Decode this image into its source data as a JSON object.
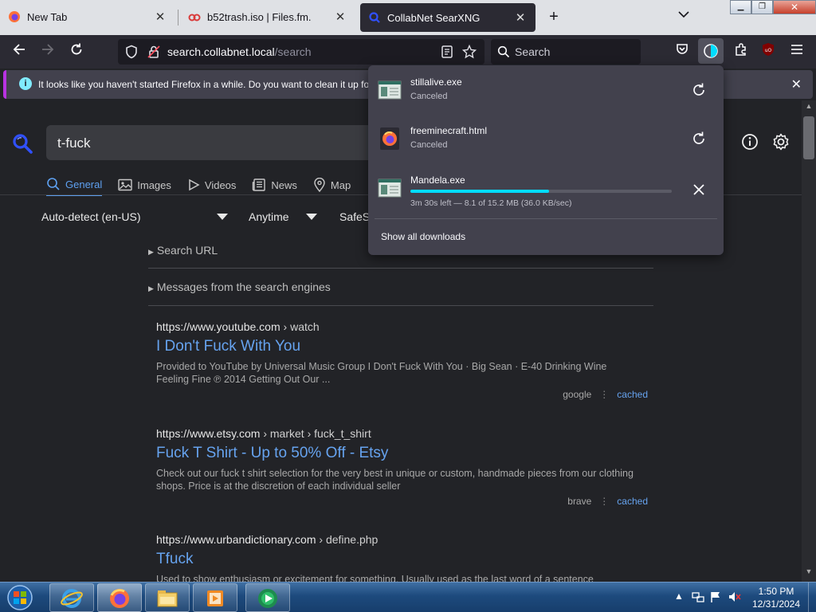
{
  "browser": {
    "tabs": [
      {
        "title": "New Tab",
        "active": false
      },
      {
        "title": "b52trash.iso | Files.fm.",
        "active": false
      },
      {
        "title": "CollabNet SearXNG",
        "active": true
      }
    ],
    "url": {
      "host": "search.collabnet.local",
      "path": "/search"
    },
    "search_placeholder": "Search",
    "notification": "It looks like you haven't started Firefox in a while. Do you want to clean it up for"
  },
  "downloads": {
    "items": [
      {
        "name": "stillalive.exe",
        "status": "Canceled",
        "action": "retry-icon"
      },
      {
        "name": "freeminecraft.html",
        "status": "Canceled",
        "action": "retry-icon"
      },
      {
        "name": "Mandela.exe",
        "status": "3m 30s left — 8.1 of 15.2 MB (36.0 KB/sec)",
        "progress": 0.53,
        "action": "cancel-icon"
      }
    ],
    "show_all": "Show all downloads"
  },
  "searx": {
    "query": "t-fuck",
    "tabs": [
      "General",
      "Images",
      "Videos",
      "News",
      "Map"
    ],
    "active_tab": "General",
    "filters": {
      "language": "Auto-detect (en-US)",
      "time": "Anytime",
      "safesearch": "SafeS"
    },
    "collapsibles": [
      "Search URL",
      "Messages from the search engines"
    ],
    "results": [
      {
        "url": "https://www.youtube.com",
        "path": "› watch",
        "title": "I Don't Fuck With You",
        "snippet": "Provided to YouTube by Universal Music Group I Don't Fuck With You · Big Sean · E-40 Drinking Wine Feeling Fine ℗ 2014 Getting Out Our ...",
        "engine": "google",
        "cached": "cached"
      },
      {
        "url": "https://www.etsy.com",
        "path": "› market › fuck_t_shirt",
        "title": "Fuck T Shirt - Up to 50% Off - Etsy",
        "snippet": "Check out our fuck t shirt selection for the very best in unique or custom, handmade pieces from our clothing shops. Price is at the discretion of each individual seller",
        "engine": "brave",
        "cached": "cached"
      },
      {
        "url": "https://www.urbandictionary.com",
        "path": "› define.php",
        "title": "Tfuck",
        "snippet": "Used to show enthusiasm or excitement for something. Usually used as the last word of a sentence",
        "engine": "",
        "cached": ""
      }
    ]
  },
  "taskbar": {
    "apps": [
      "internet-explorer-icon",
      "firefox-icon",
      "file-explorer-icon",
      "media-player-icon",
      "media-center-icon"
    ],
    "time": "1:50 PM",
    "date": "12/31/2024"
  },
  "colors": {
    "accent_link": "#66a3ef",
    "download_progress": "#00ddff",
    "notification_border": "#b833e1"
  }
}
